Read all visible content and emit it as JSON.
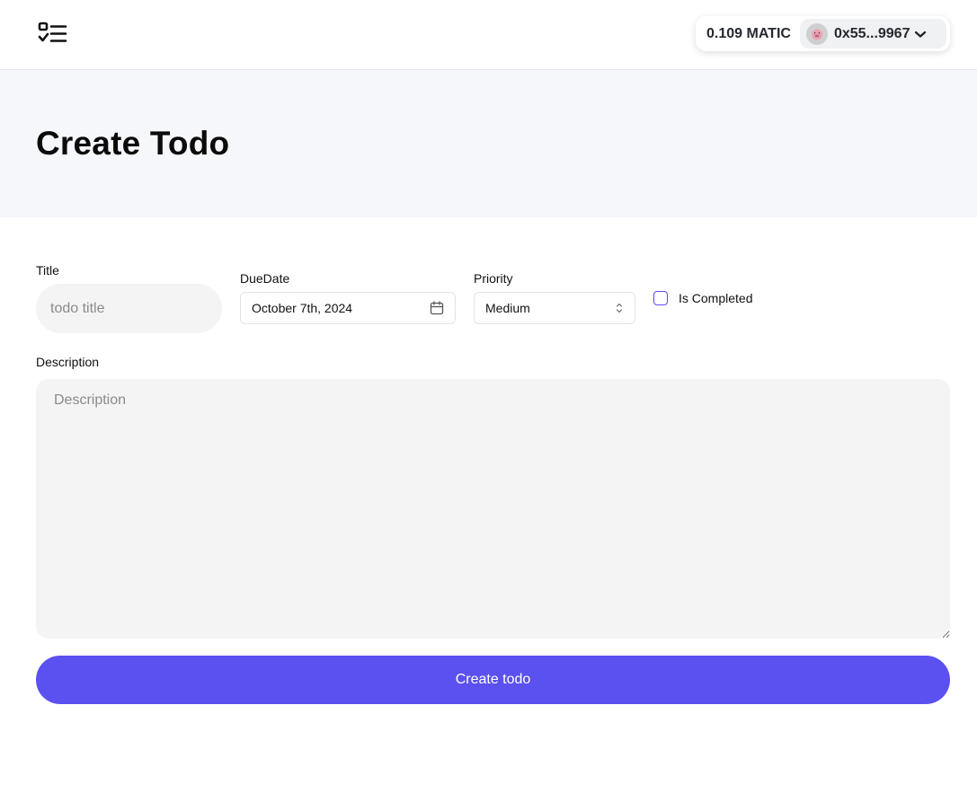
{
  "header": {
    "logo_icon": "checklist-icon",
    "wallet": {
      "balance": "0.109 MATIC",
      "avatar_icon": "pig-emoji-avatar",
      "address": "0x55...9967",
      "chevron_icon": "chevron-down-icon"
    }
  },
  "page": {
    "title": "Create Todo"
  },
  "form": {
    "title_label": "Title",
    "title_placeholder": "todo title",
    "due_date_label": "DueDate",
    "due_date_value": "October 7th, 2024",
    "calendar_icon": "calendar-icon",
    "priority_label": "Priority",
    "priority_value": "Medium",
    "priority_icon": "chevron-up-down-icon",
    "completed_label": "Is Completed",
    "completed_checked": false,
    "description_label": "Description",
    "description_placeholder": "Description",
    "submit_label": "Create todo"
  },
  "colors": {
    "accent": "#5b50f0",
    "hero_bg": "#f6f7fb",
    "input_bg": "#f4f4f4"
  }
}
